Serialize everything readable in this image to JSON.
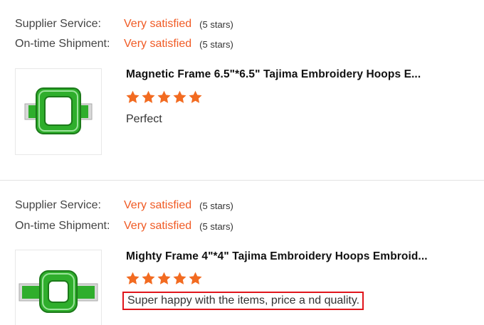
{
  "reviews": [
    {
      "supplier_label": "Supplier Service:",
      "supplier_value": "Very satisfied",
      "supplier_stars": "(5 stars)",
      "shipment_label": "On-time Shipment:",
      "shipment_value": "Very satisfied",
      "shipment_stars": "(5 stars)",
      "product_title": "Magnetic Frame 6.5\"*6.5\" Tajima Embroidery Hoops E...",
      "rating": 5,
      "feedback": "Perfect"
    },
    {
      "supplier_label": "Supplier Service:",
      "supplier_value": "Very satisfied",
      "supplier_stars": "(5 stars)",
      "shipment_label": "On-time Shipment:",
      "shipment_value": "Very satisfied",
      "shipment_stars": "(5 stars)",
      "product_title": "Mighty Frame 4\"*4\" Tajima Embroidery Hoops Embroid...",
      "rating": 5,
      "feedback": "Super happy with the items, price a nd quality."
    }
  ],
  "colors": {
    "accent": "#f05a24",
    "star": "#f26b21",
    "highlight_border": "#e0151b",
    "frame_green": "#2fae2c"
  },
  "icons": {
    "star": "star-icon",
    "product_image": "embroidery-frame-image"
  }
}
